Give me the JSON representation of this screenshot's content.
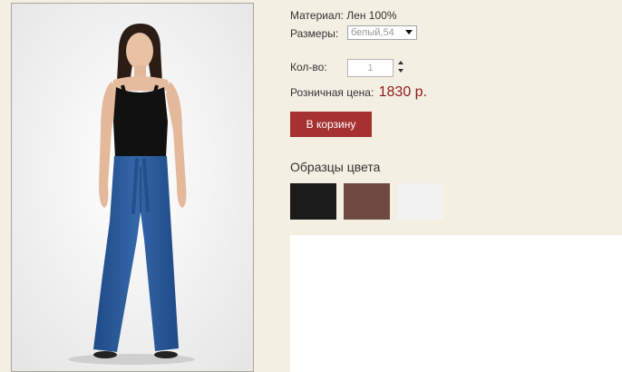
{
  "product": {
    "photo": {
      "icon": "product-photo-woman-in-blue-linen-trousers"
    },
    "material_text": "Материал: Лен 100%",
    "size": {
      "label": "Размеры:",
      "selected": "белый,54"
    },
    "quantity": {
      "label": "Кол-во:",
      "value": "1"
    },
    "price": {
      "label": "Розничная цена:",
      "value": "1830 р."
    },
    "cart_button": {
      "label": "В корзину"
    },
    "swatches": {
      "title": "Образцы цвета",
      "items": [
        {
          "color": "#1b1b1b"
        },
        {
          "color": "#6e4a42"
        },
        {
          "color": "#f2f2f2"
        }
      ]
    }
  }
}
